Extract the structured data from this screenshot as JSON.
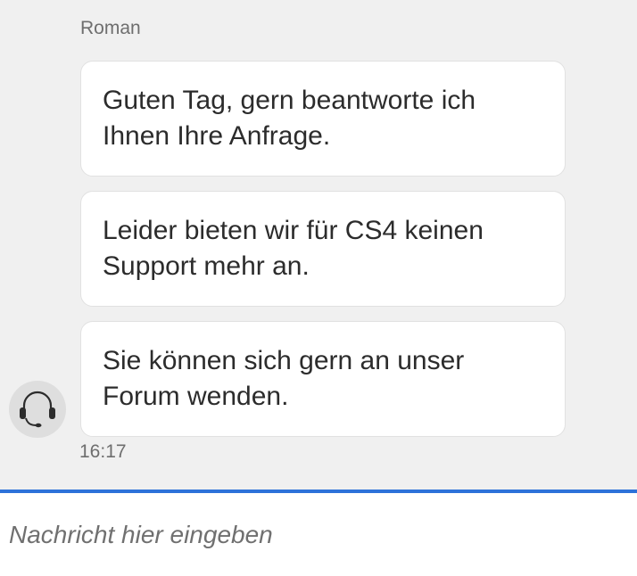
{
  "conversation": {
    "agent_name": "Roman",
    "messages": [
      {
        "text": "Guten Tag, gern beantworte ich Ihnen Ihre Anfrage."
      },
      {
        "text": "Leider bieten wir für CS4 keinen Support mehr an."
      },
      {
        "text": "Sie können sich gern an unser Forum wenden."
      }
    ],
    "timestamp": "16:17",
    "avatar_icon": "headset-icon"
  },
  "composer": {
    "placeholder": "Nachricht hier eingeben",
    "value": "",
    "accent_color": "#2d72d9"
  }
}
